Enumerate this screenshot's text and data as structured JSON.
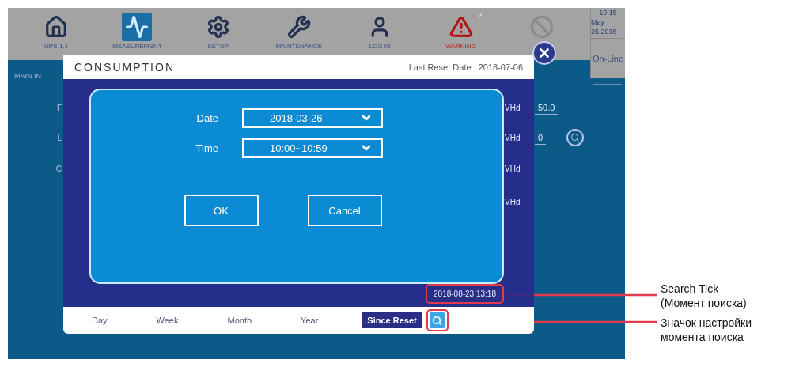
{
  "nav": [
    {
      "kind": "home",
      "label": "UPS-1.1",
      "selected": false
    },
    {
      "kind": "pulse",
      "label": "MEASUREMENT",
      "selected": true
    },
    {
      "kind": "gear",
      "label": "SETUP",
      "selected": false
    },
    {
      "kind": "wrench",
      "label": "MAINTENANCE",
      "selected": false
    },
    {
      "kind": "user",
      "label": "LOG IN",
      "selected": false
    },
    {
      "kind": "warning",
      "label": "WARNING",
      "badge": "2",
      "selected": false
    },
    {
      "kind": "mute",
      "selected": false
    }
  ],
  "status": {
    "time": "10:15",
    "date": "May 25,2016",
    "mode": "On-Line"
  },
  "backdrop": {
    "section": "MAIN IN",
    "row_labels": [
      "F",
      "L",
      "C"
    ],
    "units": [
      "VHd",
      "VHd",
      "VHd",
      "VHd"
    ],
    "values": [
      "50.0",
      "0"
    ]
  },
  "dialog": {
    "title": "CONSUMPTION",
    "last_reset": "Last Reset Date : 2018-07-06",
    "fields": [
      {
        "label": "Date",
        "value": "2018-03-26"
      },
      {
        "label": "Time",
        "value": "10:00~10:59"
      }
    ],
    "buttons": [
      "OK",
      "Cancel"
    ],
    "search_tick": "2018-08-23 13:18",
    "tabs": [
      {
        "label": "Day",
        "selected": false
      },
      {
        "label": "Week",
        "selected": false
      },
      {
        "label": "Month",
        "selected": false
      },
      {
        "label": "Year",
        "selected": false
      },
      {
        "label": "Since Reset",
        "selected": true
      }
    ]
  },
  "annotations": [
    {
      "lines": [
        "Search Tick",
        "(Момент поиска)"
      ]
    },
    {
      "lines": [
        "Значок настройки",
        "момента поиска"
      ]
    }
  ]
}
